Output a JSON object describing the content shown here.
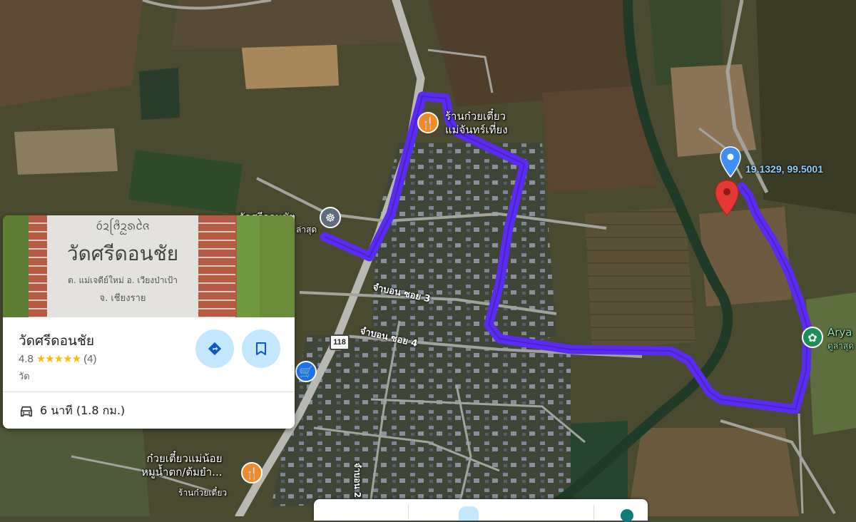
{
  "card": {
    "photo_sign_title": "วัดศรีดอนชัย",
    "photo_sign_sub1": "ต. แม่เจดีย์ใหม่ อ. เวียงป่าเป้า",
    "photo_sign_sub2": "จ. เชียงราย",
    "photo_sign_top": "ᩅᩢᨯᩆᩕᩦᨯᩬᩁᨩᩱ",
    "name": "วัดศรีดอนชัย",
    "rating": "4.8",
    "stars": "★★★★★",
    "review_count": "(4)",
    "category": "วัด",
    "travel_time": "6 นาที (1.8 กม.)"
  },
  "map": {
    "coordinates": "19.1329, 99.5001",
    "poi_noodle_top": [
      "ร้านก๋วยเตี๋ยว",
      "แม่จันทร์เที่ยง"
    ],
    "poi_temple_label": "วัดศรีดอนชัย",
    "poi_temple_sub": "ล่าสุด",
    "poi_arya": "Arya",
    "poi_arya_sub": "ดูล่าสุด",
    "poi_noodle_bottom": [
      "ก๋วยเตี๋ยวแม่น้อย",
      "หมูน้ำตก/ต้มยำ..."
    ],
    "poi_noodle_bottom_sub": "ร้านก๋วยเตี๋ยว",
    "road_label_1": "จำบอน ซอย 3",
    "road_label_2": "จำบอน ซอย 4",
    "road_label_3": "จำบอน 2",
    "highway_number": "118",
    "route_color": "#5b2cf0"
  }
}
